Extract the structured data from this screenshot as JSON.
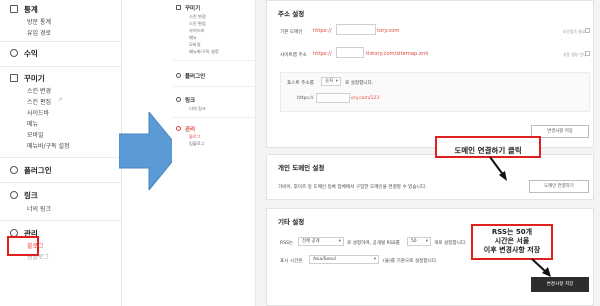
{
  "left_sidebar": {
    "stats_header": "통계",
    "stats_items": [
      "방문 통계",
      "유입 경로"
    ],
    "revenue_header": "수익",
    "decorate_header": "꾸미기",
    "decorate_items": [
      "스킨 변경",
      "스킨 편집",
      "사이드바",
      "메뉴",
      "모바일",
      "메뉴바/구독 설정"
    ],
    "plugin_header": "플러그인",
    "link_header": "링크",
    "link_items": [
      "너의 링크"
    ],
    "manage_header": "관리",
    "manage_items": [
      "블로그",
      "팀블로그"
    ]
  },
  "mini_sidebar": {
    "decorate_header": "꾸미기",
    "decorate_items": [
      "스킨 변경",
      "스킨 편집",
      "사이드바",
      "메뉴",
      "모바일",
      "메뉴바/구독 설정"
    ],
    "plugin_header": "플러그인",
    "link_header": "링크",
    "link_items": [
      "너의 링크"
    ],
    "manage_header": "관리",
    "manage_items": [
      "블로그",
      "팀블로그"
    ]
  },
  "address_settings": {
    "title": "주소 설정",
    "default_domain_label": "기본 도메인",
    "default_domain_prefix": "https://",
    "default_domain_suffix": "tory.com",
    "sitemap_label": "사이트맵 주소",
    "sitemap_prefix": "https://",
    "sitemap_suffix": "tistory.com/sitemap.xml",
    "right_note_1": "보안접속 필요",
    "right_note_2": "자동 생성 안내",
    "post_addr_label": "포스트 주소를",
    "post_addr_select": "숫자",
    "post_addr_suffix": "로 설정합니다.",
    "post_example_prefix": "https://",
    "post_example_suffix": "ory.com/123",
    "save_button": "변경사항 저장"
  },
  "personal_domain": {
    "title": "개인 도메인 설정",
    "description": "가비아, 후이즈 등 도메인 등록 업체에서 구입한 도메인을 연결할 수 있습니다.",
    "connect_button": "도메인 연결하기"
  },
  "other_settings": {
    "title": "기타 설정",
    "rss_label": "RSS는",
    "rss_select": "전체 공개",
    "rss_middle": "로 설정하며, 공개될 RSS를",
    "rss_count": "50",
    "rss_suffix": "개로 설정합니다.",
    "tz_label": "표시 시간은",
    "tz_select": "Asia/Seoul",
    "tz_suffix": "(을)를 기준으로 설정합니다.",
    "save_button": "변경사항 저장"
  },
  "annotations": {
    "domain_callout": "도메인 연결하기 클릭",
    "rss_callout_line1": "RSS는 50개",
    "rss_callout_line2": "시간은 서울",
    "rss_callout_line3": "이후 변경사항 저장"
  },
  "colors": {
    "accent_red": "#e0473b",
    "annotation_red": "#e02020",
    "arrow_blue": "#5b9bd5",
    "dark_button": "#2d2d2d"
  }
}
